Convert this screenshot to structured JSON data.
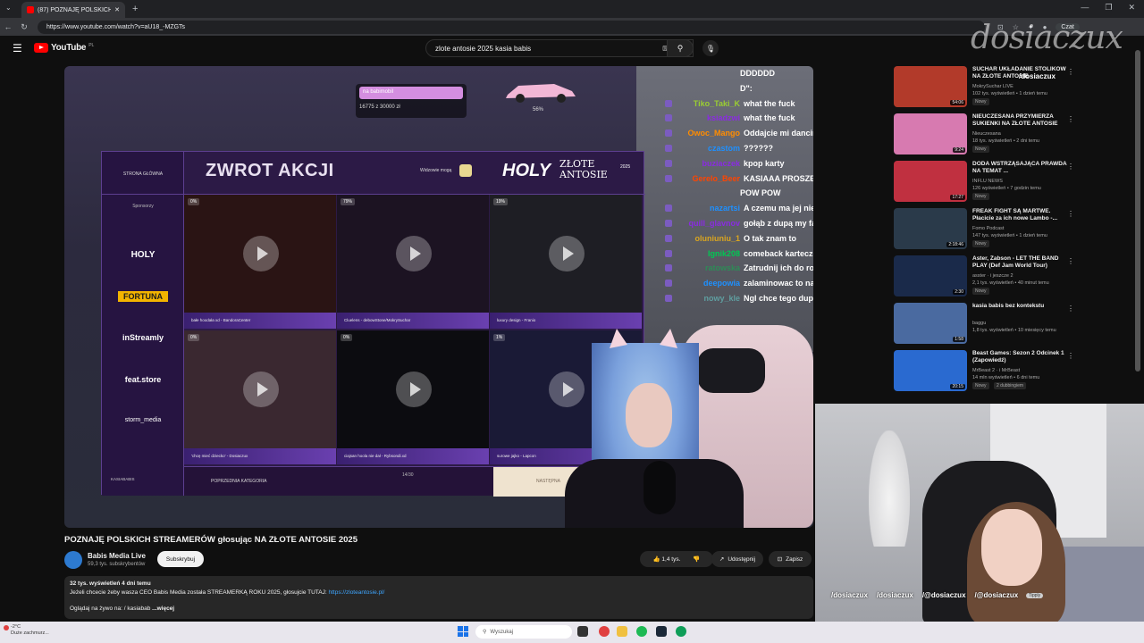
{
  "browser": {
    "tab_title": "(87) POZNAJĘ POLSKICH STREAM...",
    "url": "https://www.youtube.com/watch?v=aU18_-MZGTs",
    "profile_label": "Czat"
  },
  "youtube": {
    "logo": "YouTube",
    "region": "PL",
    "search_value": "zlote antosie 2025 kasia babis"
  },
  "video_overlay": {
    "goal_label": "na babimobil",
    "goal_progress": "16775 z 30000 zł",
    "goal_percent": "56%",
    "awards": {
      "home": "STRONA GŁÓWNA",
      "sponsors_label": "Sponsorzy",
      "sponsors": [
        "HOLY",
        "FORTUNA",
        "inStreamly",
        "feat.store",
        "storm_media"
      ],
      "title": "ZWROT AKCJI",
      "mine_label": "Widzowie mogą",
      "brand": "HOLY",
      "event": "ZŁOTE ANTOSIE",
      "year": "2025",
      "tiles": [
        {
          "badge": "0%",
          "caption": "bałe hoodała xd - BandoraCenter"
        },
        {
          "badge": "79%",
          "caption": "Cluelens - debowStone/MokrySuchar"
        },
        {
          "badge": "19%",
          "caption": "luxury design - Franio"
        },
        {
          "badge": "0%",
          "caption": "'chcę mieć dziecko' - Dosiaczux"
        },
        {
          "badge": "0%",
          "caption": "ciajsan hoola nie dał - Rybsondi.xd"
        },
        {
          "badge": "1%",
          "caption": "surowe jajko - Lapcon"
        }
      ],
      "footer_side": "KASIABABIS",
      "prev_label": "POPRZEDNIA KATEGORIA",
      "pager": "14/30",
      "next_label": "NASTĘPNA"
    },
    "chat": [
      {
        "user": "",
        "color": "#ffffff",
        "msg": "DDDDDD"
      },
      {
        "user": "",
        "color": "#ffffff",
        "msg": "D\":"
      },
      {
        "user": "Tiko_Taki_K",
        "color": "#9acd32",
        "msg": "what the fuck"
      },
      {
        "user": "ksiadzwi",
        "color": "#8a2be2",
        "msg": "what the fuck"
      },
      {
        "user": "Owoc_Mango",
        "color": "#ff8c00",
        "msg": "Oddajcie mi dancingi"
      },
      {
        "user": "czastom",
        "color": "#1e90ff",
        "msg": "??????"
      },
      {
        "user": "buziaczek",
        "color": "#8a2be2",
        "msg": "kpop karty"
      },
      {
        "user": "Gerelo_Beer",
        "color": "#ff4500",
        "msg": "KASIAAA PROSZE ZROB POW"
      },
      {
        "user": "",
        "color": "#ffffff",
        "msg": "POW POW"
      },
      {
        "user": "nazartsi",
        "color": "#1e90ff",
        "msg": "A czemu ma jej nie zdać? Japidi"
      },
      {
        "user": "quill_glavnov",
        "color": "#8a2be2",
        "msg": "gołąb z dupą my fav"
      },
      {
        "user": "oluniuniu_1",
        "color": "#daa520",
        "msg": "O tak znam to"
      },
      {
        "user": "Ignik208",
        "color": "#00c853",
        "msg": "comeback karteczek w 2k26?!"
      },
      {
        "user": "ratowska",
        "color": "#2e8b57",
        "msg": "Zatrudnij ich do robienia emotek"
      },
      {
        "user": "deepowia",
        "color": "#1e90ff",
        "msg": "zalaminowac to narychmiast"
      },
      {
        "user": "nowy_kle",
        "color": "#5f9ea0",
        "msg": "Ngl chce tego dupo gołębia"
      }
    ]
  },
  "video": {
    "title": "POZNAJĘ POLSKICH STREAMERÓW głosując NA ZŁOTE ANTOSIE 2025",
    "channel": "Babis Media Live",
    "subs": "59,3 tys. subskrybentów",
    "subscribe": "Subskrybuj",
    "likes": "1,4 tys.",
    "share": "Udostępnij",
    "save": "Zapisz",
    "meta": "32 tys. wyświetleń  4 dni temu",
    "desc_line": "Jeżeli chcecie żeby wasza CEO Babis Media została STREAMERKĄ ROKU 2025, głosujcie TUTAJ: ",
    "desc_link": "https://zloteantosie.pl/",
    "desc_live": "Oglądaj na żywo na:",
    "desc_live_ch": "/ kasiabab",
    "more": "...więcej"
  },
  "recs": [
    {
      "title": "SUCHAR UKŁADANIE STOLIKÓW NA ZŁOTE ANTOSIE",
      "channel": "MokrySuchar LIVE",
      "views": "102 tys. wyświetleń • 1 dzień temu",
      "badge": "Nowy",
      "dur": "54:06",
      "color": "#b23a2a"
    },
    {
      "title": "NIEUCZESANA PRZYMIERZA SUKIENKI NA ZŁOTE ANTOSIE",
      "channel": "Nieuczesana",
      "views": "18 tys. wyświetleń • 2 dni temu",
      "badge": "Nowy",
      "dur": "9:24",
      "color": "#d77ab0"
    },
    {
      "title": "DODA WSTRZĄSAJĄCA PRAWDA NA TEMAT ...",
      "channel": "INFLU NEWS",
      "views": "126 wyświetleń • 7 godzin temu",
      "badge": "Nowy",
      "dur": "17:27",
      "color": "#c03040"
    },
    {
      "title": "FREAK FIGHT SĄ MARTWE. Płacicie za ich nowe Lambo -...",
      "channel": "Fomo Podcast",
      "views": "147 tys. wyświetleń • 1 dzień temu",
      "badge": "Nowy",
      "dur": "2:18:46",
      "color": "#2a3a4a"
    },
    {
      "title": "Aster, Żabson - LET THE BAND PLAY (Def Jam World Tour)",
      "channel": "asster · i jeszcze 2",
      "views": "2,1 tys. wyświetleń • 40 minut temu",
      "badge": "Nowy",
      "dur": "2:30",
      "color": "#1a2a4a"
    },
    {
      "title": "kasia babis bez kontekstu",
      "channel": "baggu",
      "views": "1,8 tys. wyświetleń • 10 miesięcy temu",
      "badge": "",
      "dur": "1:58",
      "color": "#4a6aa0"
    },
    {
      "title": "Beast Games: Sezon 2 Odcinek 1 (Zapowiedź)",
      "channel": "MrBeast 2 · i MrBeast",
      "views": "14 mln wyświetleń • 6 dni temu",
      "badge": "Nowy",
      "dur": "20:15",
      "color": "#2a6ad0"
    }
  ],
  "rec_dubbing": "2 dubbingiem",
  "overlay": {
    "watermark": "dosiaczux",
    "handle": "/dosiaczux",
    "socials": [
      "/dosiaczux",
      "/dosiaczux",
      "/@dosiaczux",
      "/@dosiaczux"
    ],
    "badge": "Tipply"
  },
  "taskbar": {
    "weather_temp": "-2°C",
    "weather_desc": "Duże zachmurz...",
    "search": "Wyszukaj"
  }
}
